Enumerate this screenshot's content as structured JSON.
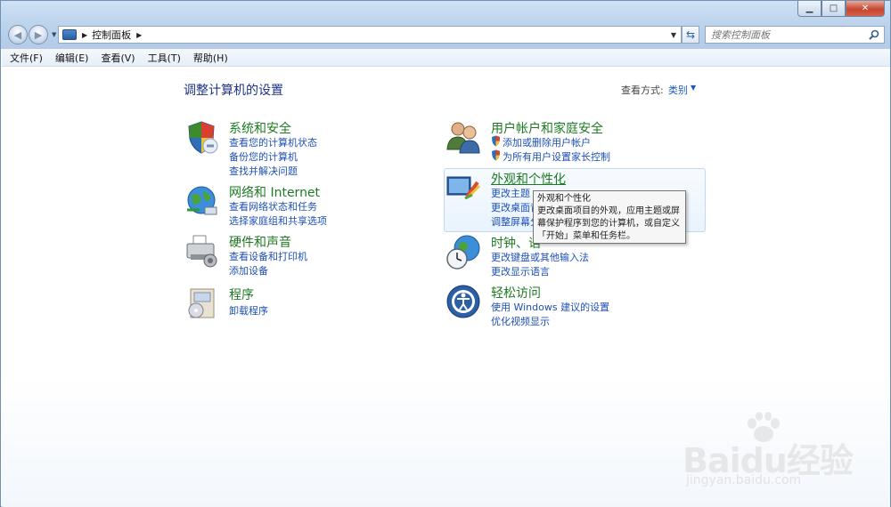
{
  "window": {
    "controls": {
      "minimize": "▁",
      "maximize": "□",
      "close": "✕"
    }
  },
  "nav": {
    "back": "◀",
    "forward": "▶",
    "dropdown": "▼"
  },
  "address": {
    "path": "控制面板",
    "separator": "▶",
    "dropdown": "▼",
    "refresh": "⇆"
  },
  "search": {
    "placeholder": "搜索控制面板"
  },
  "menu": [
    "文件(F)",
    "编辑(E)",
    "查看(V)",
    "工具(T)",
    "帮助(H)"
  ],
  "page": {
    "heading": "调整计算机的设置",
    "view_by_label": "查看方式:",
    "view_by_value": "类别",
    "view_by_arrow": "▼"
  },
  "categories": {
    "system": {
      "title": "系统和安全",
      "links": [
        "查看您的计算机状态",
        "备份您的计算机",
        "查找并解决问题"
      ]
    },
    "network": {
      "title": "网络和 Internet",
      "links": [
        "查看网络状态和任务",
        "选择家庭组和共享选项"
      ]
    },
    "hardware": {
      "title": "硬件和声音",
      "links": [
        "查看设备和打印机",
        "添加设备"
      ]
    },
    "programs": {
      "title": "程序",
      "links": [
        "卸载程序"
      ]
    },
    "users": {
      "title": "用户帐户和家庭安全",
      "links": [
        "添加或删除用户帐户",
        "为所有用户设置家长控制"
      ]
    },
    "appearance": {
      "title": "外观和个性化",
      "links": [
        "更改主题",
        "更改桌面背",
        "调整屏幕分"
      ]
    },
    "clock": {
      "title": "时钟、语",
      "links": [
        "更改键盘或其他输入法",
        "更改显示语言"
      ]
    },
    "ease": {
      "title": "轻松访问",
      "links": [
        "使用 Windows 建议的设置",
        "优化视频显示"
      ]
    }
  },
  "tooltip": {
    "lines": [
      "外观和个性化",
      "更改桌面项目的外观，应用主题或屏",
      "幕保护程序到您的计算机，或自定义",
      "「开始」菜单和任务栏。"
    ]
  },
  "watermark": {
    "text": "Baidu经验",
    "url": "jingyan.baidu.com"
  },
  "colors": {
    "category_title": "#1e7a22",
    "link": "#1e4fb8",
    "heading": "#1e3287"
  }
}
